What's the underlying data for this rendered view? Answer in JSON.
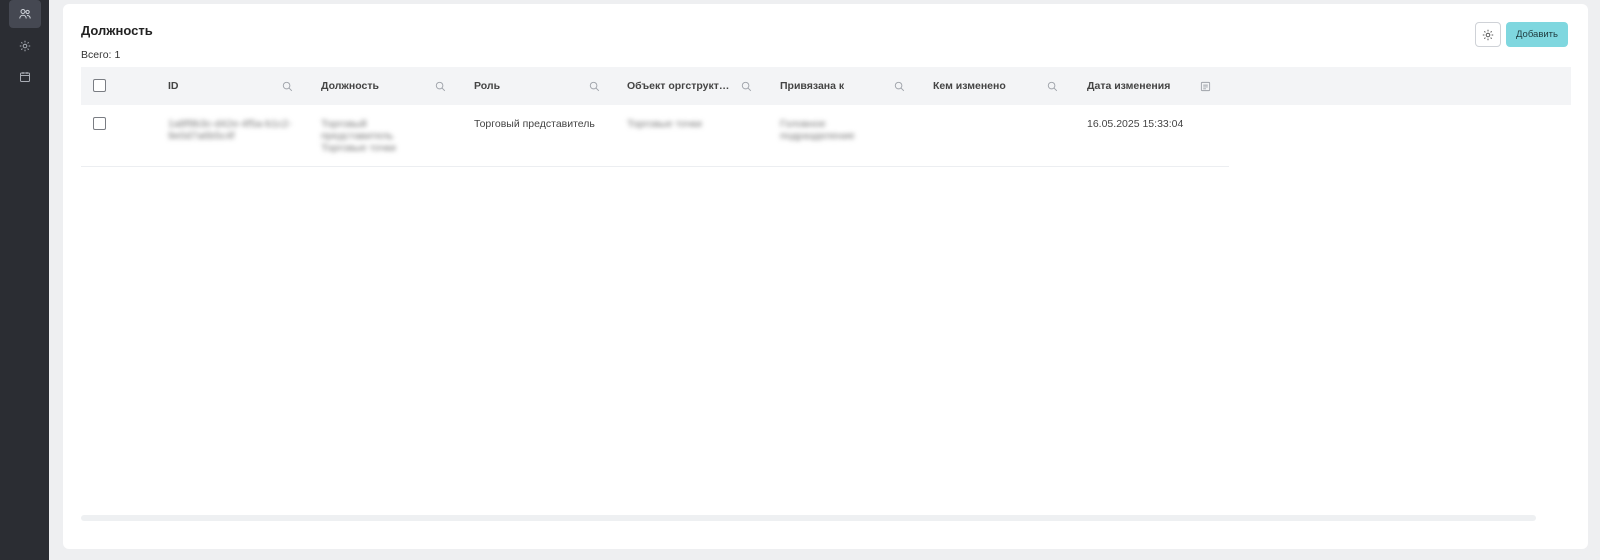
{
  "sidebar": {
    "items": [
      {
        "icon": "users-icon",
        "active": true
      },
      {
        "icon": "gear-icon",
        "active": false
      },
      {
        "icon": "calendar-icon",
        "active": false
      }
    ]
  },
  "header": {
    "title": "Должность",
    "total_label": "Всего:",
    "total_count": "1",
    "add_label": "Добавить"
  },
  "table": {
    "columns": [
      {
        "label": "ID",
        "icon": "search-icon"
      },
      {
        "label": "Должность",
        "icon": "search-icon"
      },
      {
        "label": "Роль",
        "icon": "search-icon"
      },
      {
        "label": "Объект оргструкт…",
        "icon": "search-icon"
      },
      {
        "label": "Привязана к",
        "icon": "search-icon"
      },
      {
        "label": "Кем изменено",
        "icon": "search-icon"
      },
      {
        "label": "Дата изменения",
        "icon": "calendar-icon"
      }
    ],
    "rows": [
      {
        "id": "1a8f9b3c-d42e-4f5a-b1c2-9e0d7a6b5c4f",
        "position": "Торговый представитель Торговые точки",
        "role": "Торговый представитель",
        "org_object": "Торговые точки",
        "bound_to": "Головное подразделение",
        "modified_by": "",
        "modified_at": "16.05.2025 15:33:04"
      }
    ]
  },
  "colors": {
    "sidebar_bg": "#2b2d33",
    "accent": "#7fd7df",
    "header_bg": "#f3f4f6"
  }
}
